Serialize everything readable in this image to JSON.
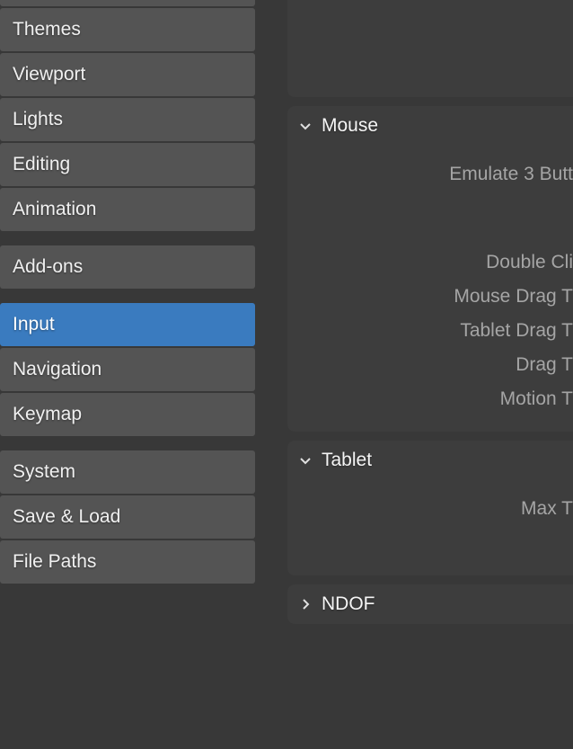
{
  "sidebar": {
    "groups": [
      {
        "items": [
          {
            "label": "Themes",
            "name": "sidebar-item-themes",
            "active": false
          },
          {
            "label": "Viewport",
            "name": "sidebar-item-viewport",
            "active": false
          },
          {
            "label": "Lights",
            "name": "sidebar-item-lights",
            "active": false
          },
          {
            "label": "Editing",
            "name": "sidebar-item-editing",
            "active": false
          },
          {
            "label": "Animation",
            "name": "sidebar-item-animation",
            "active": false
          }
        ]
      },
      {
        "items": [
          {
            "label": "Add-ons",
            "name": "sidebar-item-addons",
            "active": false
          }
        ]
      },
      {
        "items": [
          {
            "label": "Input",
            "name": "sidebar-item-input",
            "active": true
          },
          {
            "label": "Navigation",
            "name": "sidebar-item-navigation",
            "active": false
          },
          {
            "label": "Keymap",
            "name": "sidebar-item-keymap",
            "active": false
          }
        ]
      },
      {
        "items": [
          {
            "label": "System",
            "name": "sidebar-item-system",
            "active": false
          },
          {
            "label": "Save & Load",
            "name": "sidebar-item-save-load",
            "active": false
          },
          {
            "label": "File Paths",
            "name": "sidebar-item-file-paths",
            "active": false
          }
        ]
      }
    ]
  },
  "panels": {
    "mouse": {
      "label": "Mouse",
      "expanded": true,
      "rows": [
        "Emulate 3 Butt",
        "Double Cli",
        "Mouse Drag T",
        "Tablet Drag T",
        "Drag T",
        "Motion T"
      ]
    },
    "tablet": {
      "label": "Tablet",
      "expanded": true,
      "rows": [
        "Max T"
      ]
    },
    "ndof": {
      "label": "NDOF",
      "expanded": false
    }
  }
}
